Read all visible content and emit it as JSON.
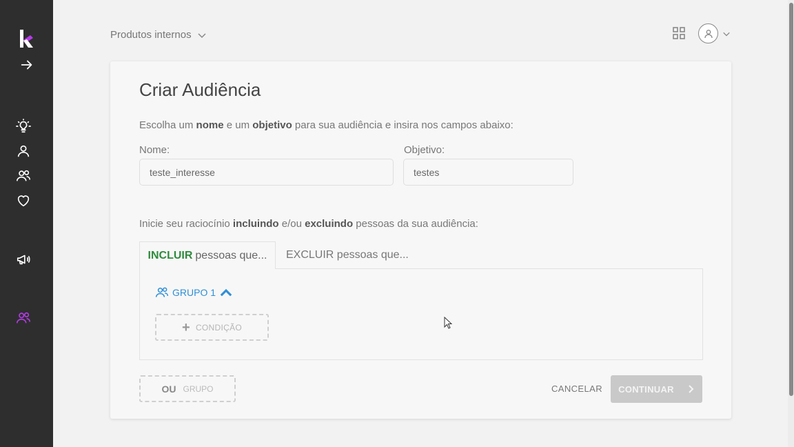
{
  "colors": {
    "sidebar_bg": "#2e2e2e",
    "accent_purple": "#b43be6",
    "group_blue": "#2f8fd6",
    "include_green": "#2e8b3e",
    "continue_disabled": "#c9c9c9"
  },
  "sidebar": {
    "items": [
      {
        "icon": "expand-arrow-icon"
      },
      {
        "icon": "lightbulb-icon"
      },
      {
        "icon": "person-icon"
      },
      {
        "icon": "people-icon"
      },
      {
        "icon": "heart-icon"
      },
      {
        "icon": "megaphone-icon"
      },
      {
        "icon": "audience-icon",
        "active": true
      }
    ]
  },
  "topbar": {
    "product_selector": "Produtos internos",
    "apps_icon": "grid-icon",
    "user_icon": "user-avatar-icon"
  },
  "form": {
    "title": "Criar Audiência",
    "intro_part1": "Escolha um ",
    "intro_bold1": "nome",
    "intro_part2": " e um ",
    "intro_bold2": "objetivo",
    "intro_part3": " para sua audiência e insira nos campos abaixo:",
    "name_label": "Nome:",
    "name_value": "teste_interesse",
    "objective_label": "Objetivo:",
    "objective_value": "testes",
    "reasoning_part1": "Inicie seu raciocínio ",
    "reasoning_bold1": "incluindo",
    "reasoning_part2": " e/ou ",
    "reasoning_bold2": "excluindo",
    "reasoning_part3": " pessoas da sua audiência:"
  },
  "tabs": {
    "include_strong": "INCLUIR",
    "include_rest": " pessoas que...",
    "exclude": "EXCLUIR pessoas que..."
  },
  "group": {
    "label": "GRUPO 1",
    "add_condition": "CONDIÇÃO"
  },
  "footer": {
    "or_label": "OU",
    "group_label": "GRUPO",
    "cancel": "CANCELAR",
    "continue": "CONTINUAR"
  }
}
